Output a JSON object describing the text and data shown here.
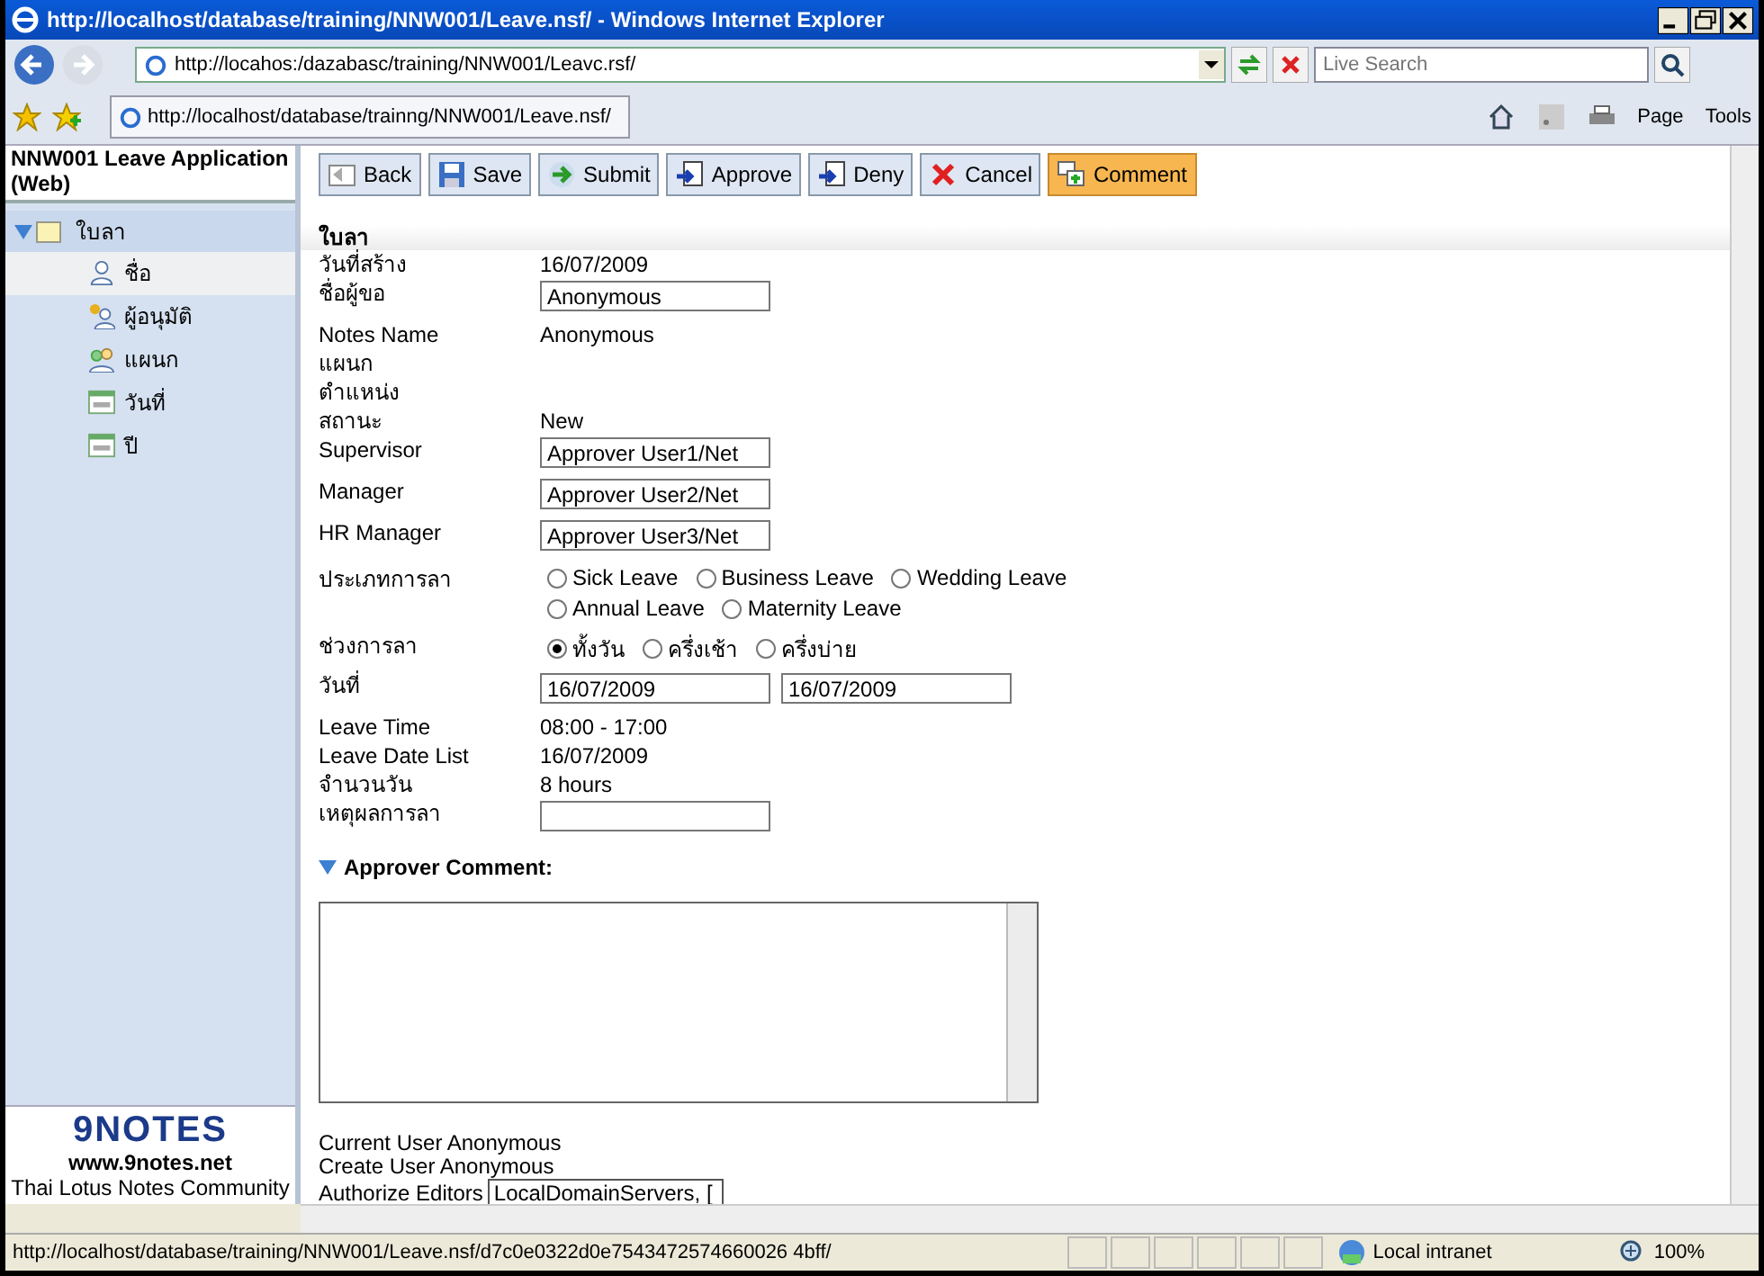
{
  "window": {
    "title": "http://localhost/database/training/NNW001/Leave.nsf/ - Windows Internet Explorer"
  },
  "address_bar": {
    "url": "http://locahos:/dazabasc/training/NNW001/Leavc.rsf/"
  },
  "search": {
    "placeholder": "Live Search"
  },
  "tab": {
    "title": "http://localhost/database/trainng/NNW001/Leave.nsf/"
  },
  "command_bar": [
    {
      "label": "Page"
    },
    {
      "label": "Tools"
    }
  ],
  "sidebar": {
    "title": "NNW001 Leave Application (Web)",
    "tree": {
      "label": "ใบลา",
      "expanded": true,
      "children": [
        {
          "label": "ชื่อ",
          "kind": "person",
          "selected": true
        },
        {
          "label": "ผู้อนุมัติ",
          "kind": "approver",
          "selected": false
        },
        {
          "label": "แผนก",
          "kind": "group",
          "selected": false
        },
        {
          "label": "วันที่",
          "kind": "calendar",
          "selected": false
        },
        {
          "label": "ปี",
          "kind": "calendar",
          "selected": false
        }
      ]
    },
    "logo": "9NOTES",
    "site": "www.9notes.net",
    "tagline": "Thai Lotus Notes Community"
  },
  "toolbar": [
    {
      "label": "Back",
      "kind": "back",
      "highlighted": false
    },
    {
      "label": "Save",
      "kind": "save",
      "highlighted": false
    },
    {
      "label": "Submit",
      "kind": "submit",
      "highlighted": false
    },
    {
      "label": "Approve",
      "kind": "approve",
      "highlighted": false
    },
    {
      "label": "Deny",
      "kind": "deny",
      "highlighted": false
    },
    {
      "label": "Cancel",
      "kind": "cancel",
      "highlighted": false
    },
    {
      "label": "Comment",
      "kind": "comment",
      "highlighted": true
    }
  ],
  "form": {
    "title": "ใบลา",
    "fields": [
      {
        "kind": "text",
        "label": "วันที่สร้าง",
        "value": "16/07/2009"
      },
      {
        "kind": "input",
        "label": "ชื่อผู้ขอ",
        "value": "Anonymous"
      },
      {
        "kind": "text",
        "label": "Notes Name",
        "value": "Anonymous"
      },
      {
        "kind": "text",
        "label": "แผนก"
      },
      {
        "kind": "text",
        "label": "ตำแหน่ง"
      },
      {
        "kind": "text",
        "label": "สถานะ",
        "value": "New"
      },
      {
        "kind": "input",
        "label": "Supervisor",
        "value": "Approver User1/Net"
      },
      {
        "kind": "input",
        "label": "Manager",
        "value": "Approver User2/Net"
      },
      {
        "kind": "input",
        "label": "HR Manager",
        "value": "Approver User3/Net"
      },
      {
        "kind": "radio",
        "label": "ประเภทการลา",
        "options": [
          {
            "label": "Sick Leave",
            "selected": false
          },
          {
            "label": "Business Leave",
            "selected": false
          },
          {
            "label": "Wedding Leave",
            "selected": false
          },
          {
            "label": "Annual Leave",
            "selected": false
          },
          {
            "label": "Maternity Leave",
            "selected": false
          }
        ]
      },
      {
        "kind": "radio",
        "label": "ช่วงการลา",
        "options": [
          {
            "label": "ทั้งวัน",
            "selected": true
          },
          {
            "label": "ครึ่งเช้า",
            "selected": false
          },
          {
            "label": "ครึ่งบ่าย",
            "selected": false
          }
        ]
      },
      {
        "kind": "range",
        "label": "วันที่",
        "values": [
          "16/07/2009",
          "16/07/2009"
        ]
      },
      {
        "kind": "text",
        "label": "Leave Time",
        "value": "08:00 - 17:00"
      },
      {
        "kind": "text",
        "label": "Leave Date List",
        "value": "16/07/2009"
      },
      {
        "kind": "text",
        "label": "จำนวนวัน",
        "value": "8 hours"
      },
      {
        "kind": "input",
        "label": "เหตุผลการลา"
      }
    ]
  },
  "comment": {
    "heading": "Approver Comment:",
    "expanded": true
  },
  "footer": {
    "lines": [
      "Current User Anonymous",
      "Create User Anonymous"
    ],
    "editors_label": "Authorize Editors",
    "editors_value": "LocalDomainServers, ["
  },
  "status_bar": {
    "url": "http://localhost/database/training/NNW001/Leave.nsf/d7c0e0322d0e7543472574660026 4bff/",
    "zone": "Local intranet",
    "zoom": "100%"
  }
}
